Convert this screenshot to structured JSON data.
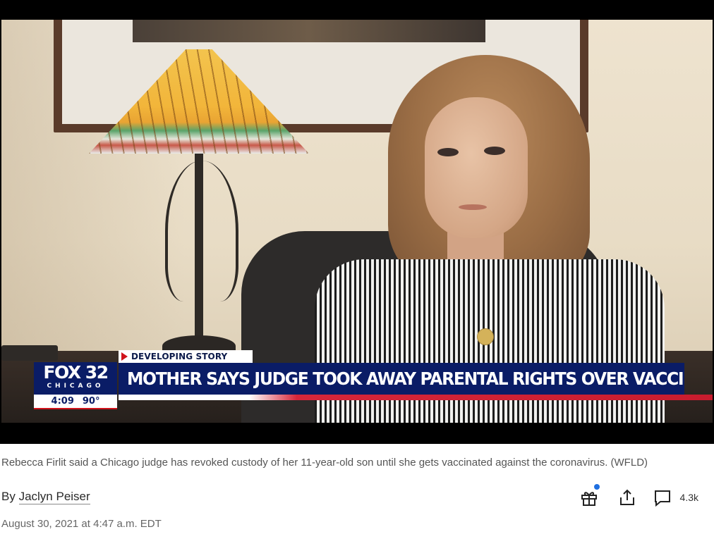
{
  "video": {
    "tag": "DEVELOPING STORY",
    "headline": "MOTHER SAYS JUDGE TOOK AWAY PARENTAL RIGHTS OVER VACCINE",
    "logo_main": "FOX 32",
    "logo_sub": "CHICAGO",
    "time": "4:09",
    "temperature": "90°"
  },
  "caption": "Rebecca Firlit said a Chicago judge has revoked custody of her 11-year-old son until she gets vaccinated against the coronavirus. (WFLD)",
  "byline": {
    "prefix": "By",
    "author": "Jaclyn Peiser"
  },
  "dateline": "August 30, 2021 at 4:47 a.m. EDT",
  "actions": {
    "gift_icon": "gift-icon",
    "share_icon": "share-icon",
    "comment_icon": "comment-icon",
    "comment_count": "4.3k",
    "notification_color": "#1f6fe0"
  }
}
